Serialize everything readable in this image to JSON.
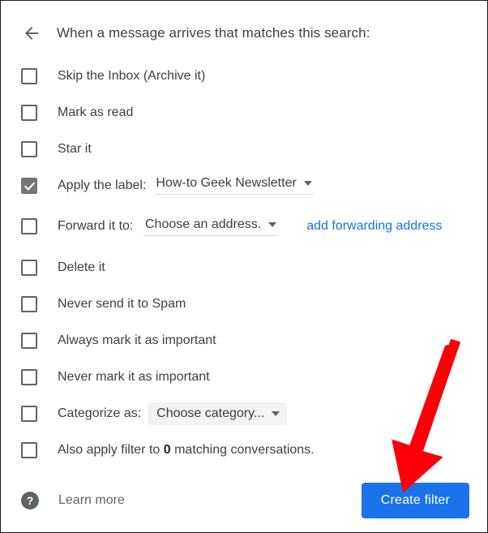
{
  "header": {
    "back_icon": "back-arrow-icon",
    "title": "When a message arrives that matches this search:"
  },
  "options": [
    {
      "label": "Skip the Inbox (Archive it)",
      "checked": false
    },
    {
      "label": "Mark as read",
      "checked": false
    },
    {
      "label": "Star it",
      "checked": false
    },
    {
      "label": "Apply the label:",
      "checked": true,
      "dropdown": "How-to Geek Newsletter",
      "dropdown_style": "underline"
    },
    {
      "label": "Forward it to:",
      "checked": false,
      "dropdown": "Choose an address.",
      "dropdown_style": "underline",
      "link": "add forwarding address"
    },
    {
      "label": "Delete it",
      "checked": false
    },
    {
      "label": "Never send it to Spam",
      "checked": false
    },
    {
      "label": "Always mark it as important",
      "checked": false
    },
    {
      "label": "Never mark it as important",
      "checked": false
    },
    {
      "label": "Categorize as:",
      "checked": false,
      "dropdown": "Choose category...",
      "dropdown_style": "box"
    },
    {
      "label_prefix": "Also apply filter to ",
      "label_bold": "0",
      "label_suffix": " matching conversations.",
      "checked": false
    }
  ],
  "footer": {
    "help_icon": "help-circle-icon",
    "learn_more": "Learn more",
    "create_filter": "Create filter"
  },
  "annotation": {
    "type": "red-arrow",
    "color": "#fb0007",
    "points_to": "create-filter-button"
  },
  "colors": {
    "accent_blue": "#1a73e8",
    "link_blue": "#1a73e8",
    "text": "#3c4043",
    "checkbox_border": "#5f6368",
    "checked_fill": "#757575",
    "dropdown_box_bg": "#f1f3f4",
    "annotation_red": "#fb0007"
  }
}
